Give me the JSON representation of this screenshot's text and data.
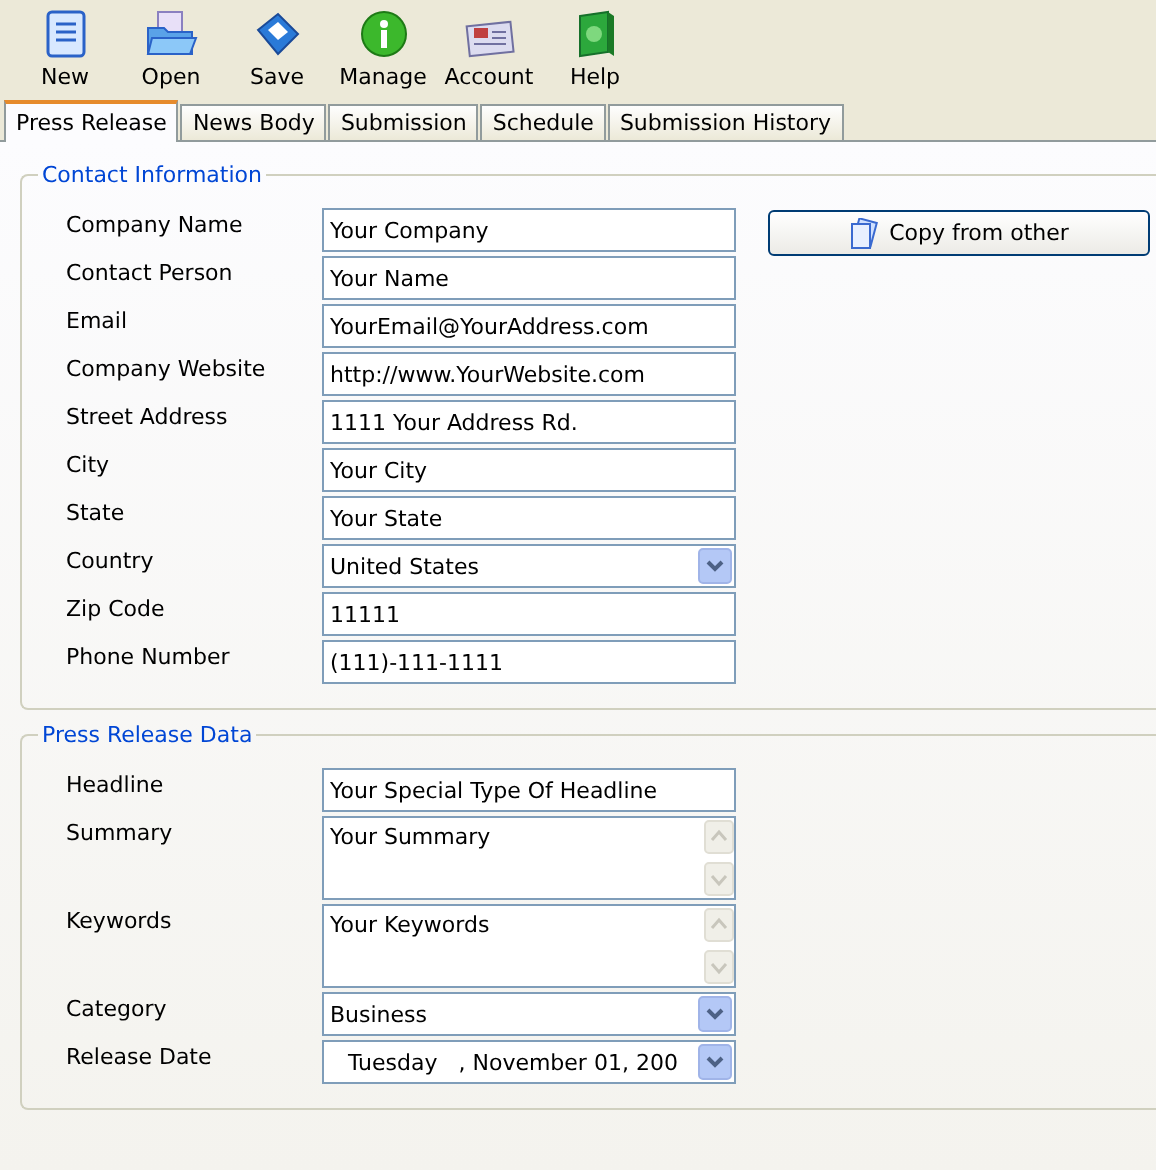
{
  "toolbar": [
    {
      "label": "New",
      "kind": "new"
    },
    {
      "label": "Open",
      "kind": "open"
    },
    {
      "label": "Save",
      "kind": "save"
    },
    {
      "label": "Manage",
      "kind": "manage"
    },
    {
      "label": "Account",
      "kind": "account"
    },
    {
      "label": "Help",
      "kind": "help"
    }
  ],
  "tabs": [
    {
      "label": "Press Release",
      "selected": true
    },
    {
      "label": "News Body",
      "selected": false
    },
    {
      "label": "Submission",
      "selected": false
    },
    {
      "label": "Schedule",
      "selected": false
    },
    {
      "label": "Submission History",
      "selected": false
    }
  ],
  "sections": [
    {
      "title": "Contact Information",
      "button": "Copy from other",
      "fields": [
        {
          "label": "Company Name",
          "kind": "text",
          "value": "Your Company"
        },
        {
          "label": "Contact Person",
          "kind": "text",
          "value": "Your Name"
        },
        {
          "label": "Email",
          "kind": "text",
          "value": "YourEmail@YourAddress.com"
        },
        {
          "label": "Company Website",
          "kind": "text",
          "value": "http://www.YourWebsite.com"
        },
        {
          "label": "Street Address",
          "kind": "text",
          "value": "1111 Your Address Rd."
        },
        {
          "label": "City",
          "kind": "text",
          "value": "Your City"
        },
        {
          "label": "State",
          "kind": "text",
          "value": "Your State"
        },
        {
          "label": "Country",
          "kind": "select",
          "value": "United States"
        },
        {
          "label": "Zip Code",
          "kind": "text",
          "value": "11111"
        },
        {
          "label": "Phone Number",
          "kind": "text",
          "value": "(111)-111-1111"
        }
      ]
    },
    {
      "title": "Press Release Data",
      "fields": [
        {
          "label": "Headline",
          "kind": "text",
          "value": "Your Special Type Of Headline"
        },
        {
          "label": "Summary",
          "kind": "textarea",
          "value": "Your Summary"
        },
        {
          "label": "Keywords",
          "kind": "textarea",
          "value": "Your Keywords"
        },
        {
          "label": "Category",
          "kind": "select",
          "value": "Business"
        },
        {
          "label": "Release Date",
          "kind": "date",
          "value": "Tuesday   , November 01, 200"
        }
      ]
    }
  ]
}
